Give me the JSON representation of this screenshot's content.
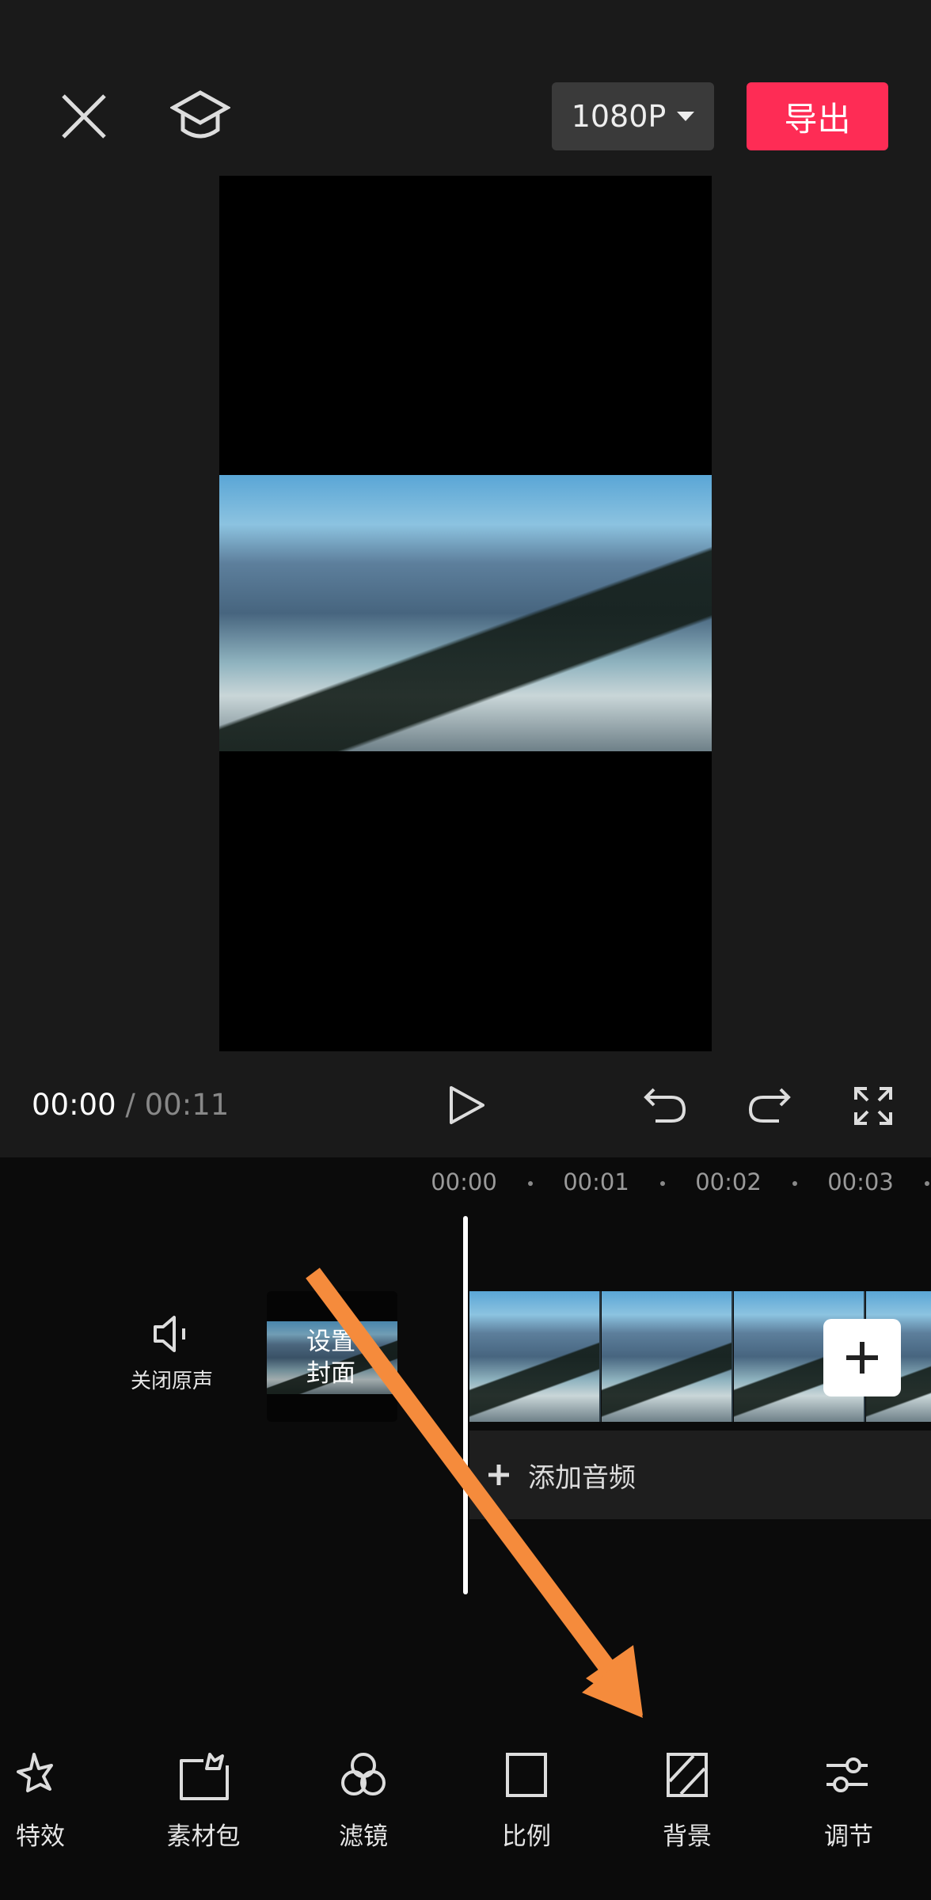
{
  "header": {
    "close_icon": "close-icon",
    "tutorial_icon": "graduation-cap-icon",
    "resolution": "1080P",
    "export_label": "导出",
    "export_color": "#fe2c55"
  },
  "player": {
    "current_time": "00:00",
    "separator": "/",
    "total_time": "00:11"
  },
  "timeline": {
    "ruler": [
      "00:00",
      "00:01",
      "00:02",
      "00:03"
    ],
    "mute_label": "关闭原声",
    "cover_label_1": "设置",
    "cover_label_2": "封面",
    "add_audio_label": "添加音频"
  },
  "annotation": {
    "arrow_color": "#f58b3c"
  },
  "toolbar": [
    {
      "label": "特效",
      "icon": "star-effects-icon"
    },
    {
      "label": "素材包",
      "icon": "material-pack-icon"
    },
    {
      "label": "滤镜",
      "icon": "filter-icon"
    },
    {
      "label": "比例",
      "icon": "ratio-icon"
    },
    {
      "label": "背景",
      "icon": "background-icon"
    },
    {
      "label": "调节",
      "icon": "adjust-icon"
    }
  ]
}
